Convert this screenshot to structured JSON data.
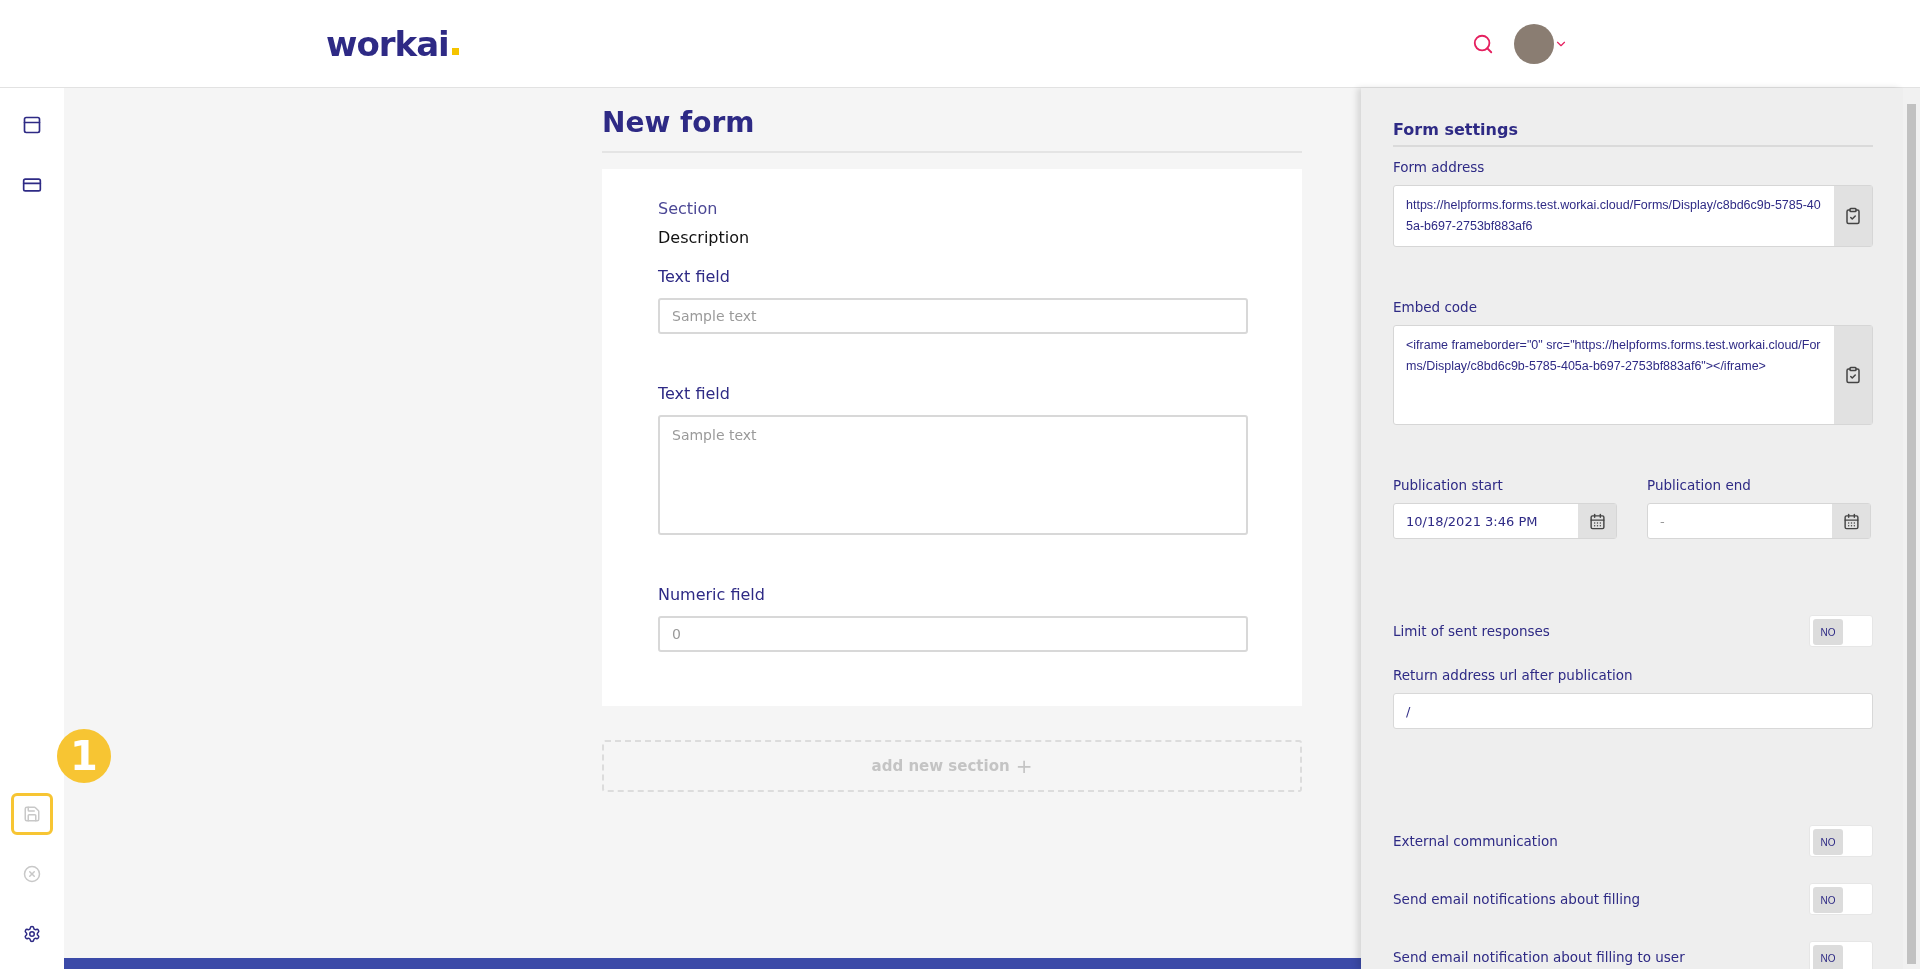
{
  "header": {
    "logo": "workai"
  },
  "sidebar": {
    "top_items": [
      {
        "kind": "layout"
      },
      {
        "kind": "card"
      }
    ],
    "bottom_items": [
      {
        "kind": "save",
        "disabled": true,
        "highlighted": true
      },
      {
        "kind": "close",
        "disabled": true,
        "highlighted": false
      },
      {
        "kind": "settings",
        "disabled": false,
        "highlighted": false
      }
    ]
  },
  "annotation": {
    "label": "1"
  },
  "form": {
    "title": "New form",
    "section_title": "Section",
    "description": "Description",
    "fields": [
      {
        "kind": "text",
        "label": "Text field",
        "placeholder": "Sample text"
      },
      {
        "kind": "textarea",
        "label": "Text field",
        "placeholder": "Sample text"
      },
      {
        "kind": "number",
        "label": "Numeric field",
        "placeholder": "0"
      }
    ],
    "add_section": "add new section",
    "add_icon": "+"
  },
  "settings": {
    "title": "Form settings",
    "form_address": {
      "label": "Form address",
      "value": "https://helpforms.forms.test.workai.cloud/Forms/Display/c8bd6c9b-5785-405a-b697-2753bf883af6"
    },
    "embed_code": {
      "label": "Embed code",
      "value": "<iframe frameborder=\"0\" src=\"https://helpforms.forms.test.workai.cloud/Forms/Display/c8bd6c9b-5785-405a-b697-2753bf883af6\"></iframe>"
    },
    "publication_start": {
      "label": "Publication start",
      "value": "10/18/2021 3:46 PM"
    },
    "publication_end": {
      "label": "Publication end",
      "placeholder": "-"
    },
    "toggles_a": [
      {
        "label": "Limit of sent responses",
        "on": false,
        "text": "NO"
      }
    ],
    "return_url": {
      "label": "Return address url after publication",
      "value": "/"
    },
    "toggles_b": [
      {
        "label": "External communication",
        "on": false,
        "text": "NO"
      },
      {
        "label": "Send email notifications about filling",
        "on": false,
        "text": "NO"
      },
      {
        "label": "Send email notification about filling to user",
        "on": false,
        "text": "NO"
      }
    ]
  }
}
